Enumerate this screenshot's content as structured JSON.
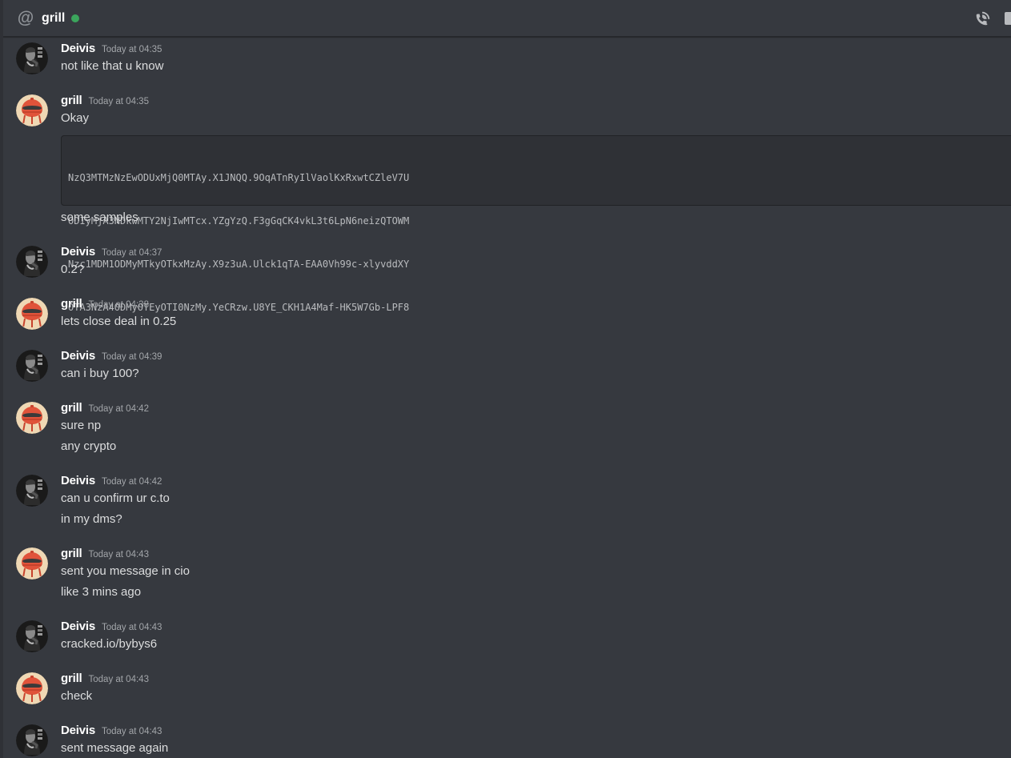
{
  "header": {
    "channel_icon": "at-sign-icon",
    "channel_name": "grill",
    "status": "online",
    "status_color": "#3ba55c",
    "actions": [
      "start-voice-call-icon",
      "start-video-call-icon"
    ]
  },
  "users": {
    "deivis": {
      "name": "Deivis",
      "avatar": "noir-portrait-avatar"
    },
    "grill": {
      "name": "grill",
      "avatar": "grill-avatar"
    }
  },
  "messages": [
    {
      "author": "Deivis",
      "timestamp": "Today at 04:35",
      "lines": [
        "not like that u know"
      ]
    },
    {
      "author": "grill",
      "timestamp": "Today at 04:35",
      "lines": [
        "Okay"
      ],
      "code": [
        "NzQ3MTMzNzEwODUxMjQ0MTAy.X1JNQQ.9OqATnRyIlVaolKxRxwtCZleV7U",
        "ODIyMjA3NDkwMTY2NjIwMTcx.YZgYzQ.F3gGqCK4vkL3t6LpN6neizQTOWM",
        "Nzc1MDM1ODMyMTkyOTkxMzAy.X9z3uA.Ulck1qTA-EAA0Vh99c-xlyvddXY",
        "OTA3NzA4ODMyOTEyOTI0NzMy.YeCRzw.U8YE_CKH1A4Maf-HK5W7Gb-LPF8"
      ],
      "after_code": [
        "some samples"
      ]
    },
    {
      "author": "Deivis",
      "timestamp": "Today at 04:37",
      "lines": [
        "0.2?"
      ]
    },
    {
      "author": "grill",
      "timestamp": "Today at 04:38",
      "lines": [
        "lets close deal in 0.25"
      ]
    },
    {
      "author": "Deivis",
      "timestamp": "Today at 04:39",
      "lines": [
        "can i buy 100?"
      ]
    },
    {
      "author": "grill",
      "timestamp": "Today at 04:42",
      "lines": [
        "sure np",
        "any crypto"
      ]
    },
    {
      "author": "Deivis",
      "timestamp": "Today at 04:42",
      "lines": [
        "can u confirm ur c.to",
        "in my dms?"
      ]
    },
    {
      "author": "grill",
      "timestamp": "Today at 04:43",
      "lines": [
        "sent you message in cio",
        "like 3 mins ago"
      ]
    },
    {
      "author": "Deivis",
      "timestamp": "Today at 04:43",
      "lines": [
        "cracked.io/bybys6"
      ]
    },
    {
      "author": "grill",
      "timestamp": "Today at 04:43",
      "lines": [
        "check"
      ]
    },
    {
      "author": "Deivis",
      "timestamp": "Today at 04:43",
      "lines": [
        "sent message again"
      ]
    }
  ]
}
